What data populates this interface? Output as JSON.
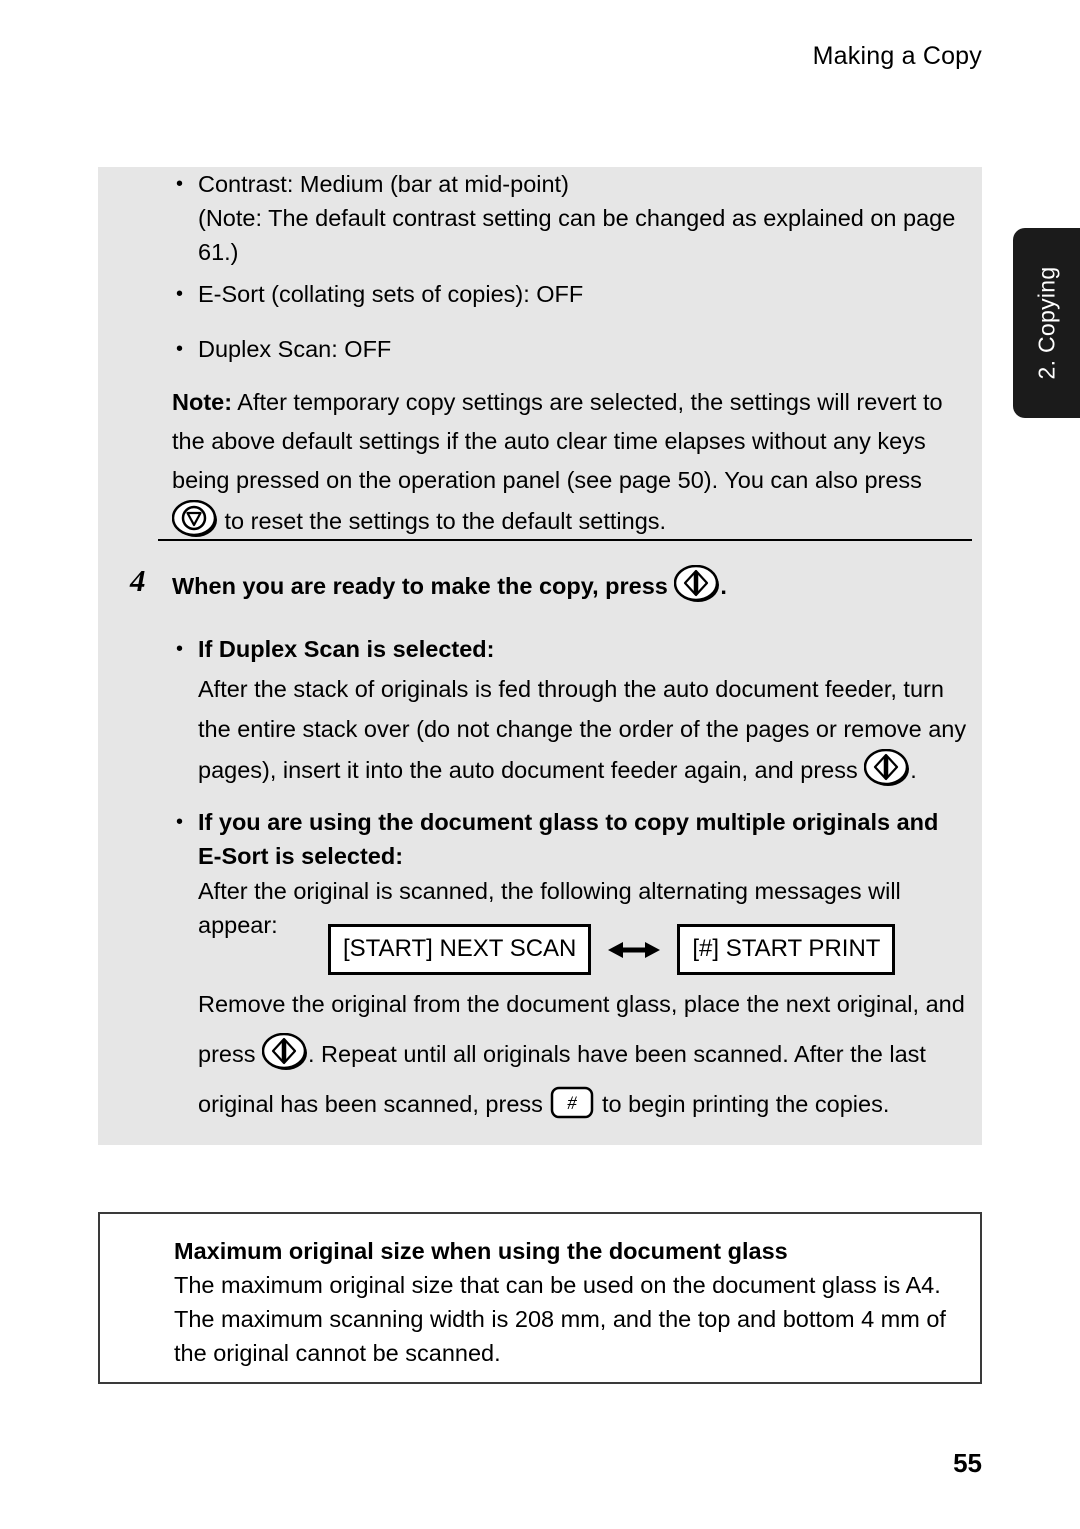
{
  "header": {
    "running_title": "Making a Copy"
  },
  "side_tab": {
    "label": "2. Copying"
  },
  "gray_panel": {
    "bullets": [
      {
        "marker": "•",
        "lines": [
          "Contrast: Medium (bar at mid-point)",
          "(Note: The default contrast setting can be changed as explained on page",
          "61.)"
        ],
        "text": "Contrast: Medium (bar at mid-point) (Note: The default contrast setting can be changed as explained on page 61.)"
      },
      {
        "marker": "•",
        "text": "E-Sort (collating sets of copies): OFF"
      },
      {
        "marker": "•",
        "text": "Duplex Scan: OFF"
      }
    ],
    "note": {
      "label": "Note:",
      "body_part1": " After temporary copy settings are selected, the settings will revert to the above default settings if the auto clear time elapses without any keys being pressed on the operation panel (see page 50). You can also press ",
      "icon": "stop-key-icon",
      "body_part2": " to reset the settings to the default settings."
    },
    "step": {
      "number": "4",
      "heading_before_icon": "When you are ready to make the copy, press ",
      "heading_icon": "start-key-icon",
      "heading_after_icon": "."
    },
    "sub_bullets": [
      {
        "marker": "•",
        "heading": "If Duplex Scan is selected:",
        "body_part1": "After the stack of originals is fed through the auto document feeder, turn the entire stack over (do not change the order of the pages or remove any pages), insert it into the auto document feeder again, and press ",
        "icon": "start-key-icon",
        "body_part2": "."
      },
      {
        "marker": "•",
        "heading": "If you are using the document glass to copy multiple originals and E-Sort is selected:",
        "body_part1": "After the original is scanned, the following alternating messages will appear:"
      }
    ],
    "display_messages": {
      "left": "[START] NEXT SCAN",
      "arrow": "double-arrow-icon",
      "right": "[#] START PRINT"
    },
    "closing": {
      "part1": "Remove the original from the document glass, place the next original, and press ",
      "icon1": "start-key-icon",
      "part2": ". Repeat until all originals have been scanned. After the last original has been scanned, press ",
      "icon2": "hash-key-icon",
      "part3": " to begin printing the copies."
    }
  },
  "note_box": {
    "title": "Maximum original size when using the document glass",
    "lines": [
      "The maximum original size that can be used on the document glass is A4.",
      "The maximum scanning width is 208 mm, and the top and bottom 4 mm of",
      "the original cannot be scanned."
    ],
    "body": "The maximum original size that can be used on the document glass is A4. The maximum scanning width is 208 mm, and the top and bottom 4 mm of the original cannot be scanned."
  },
  "footer": {
    "page_number": "55"
  },
  "colors": {
    "panel_background": "#e6e6e6",
    "tab_background": "#1b1b1b",
    "text": "#000000",
    "page_background": "#ffffff"
  }
}
